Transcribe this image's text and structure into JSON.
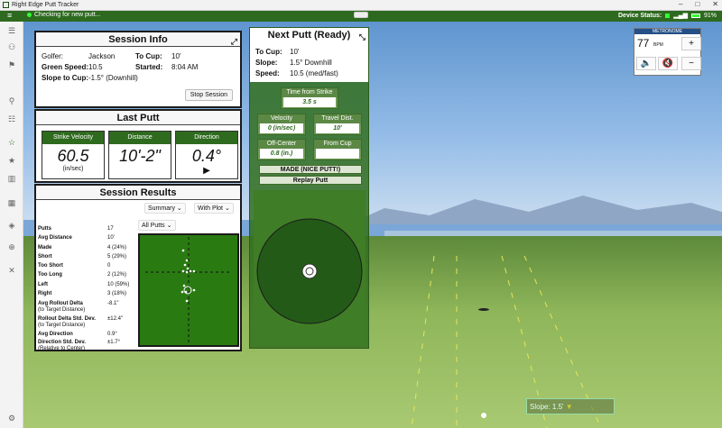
{
  "window": {
    "title": "Right Edge Putt Tracker",
    "minimize": "–",
    "maximize": "□",
    "close": "✕"
  },
  "toolbar": {
    "status_text": "Checking for new putt...",
    "device_status_label": "Device Status:",
    "battery": "91%"
  },
  "sidebar": {
    "items": [
      "menu",
      "people",
      "golf-flag",
      "person-add",
      "list",
      "star-outline",
      "star-fill",
      "building",
      "chart",
      "layers",
      "globe",
      "close",
      "gear"
    ]
  },
  "session_info": {
    "title": "Session Info",
    "golfer_label": "Golfer:",
    "golfer": "Jackson",
    "to_cup_label": "To Cup:",
    "to_cup": "10'",
    "green_speed_label": "Green Speed:",
    "green_speed": "10.5",
    "started_label": "Started:",
    "started": "8:04 AM",
    "slope_label": "Slope to Cup:",
    "slope": "-1.5° (Downhill)",
    "stop_button": "Stop Session"
  },
  "last_putt": {
    "title": "Last Putt",
    "boxes": [
      {
        "label": "Strike Velocity",
        "value": "60.5",
        "unit": "(in/sec)"
      },
      {
        "label": "Distance",
        "value": "10'-2\"",
        "unit": ""
      },
      {
        "label": "Direction",
        "value": "0.4°",
        "unit": ""
      }
    ],
    "direction_arrow": "▶"
  },
  "session_results": {
    "title": "Session Results",
    "view_select": "Summary",
    "plot_select": "With Plot",
    "putt_filter": "All Putts",
    "rows": [
      {
        "k": "Putts",
        "v": "17"
      },
      {
        "k": "Avg Distance",
        "v": "10'"
      },
      {
        "k": "Made",
        "v": "4 (24%)"
      },
      {
        "k": "Short",
        "v": "5 (29%)"
      },
      {
        "k": "Too Short",
        "v": "0"
      },
      {
        "k": "Too Long",
        "v": "2 (12%)"
      },
      {
        "k": "Left",
        "v": "10 (59%)"
      },
      {
        "k": "Right",
        "v": "3 (18%)"
      },
      {
        "k": "Avg Rollout Delta",
        "sub": "(to Target Distance)",
        "v": "-8.1\""
      },
      {
        "k": "Rollout Delta Std. Dev.",
        "sub": "(to Target Distance)",
        "v": "±12.4\""
      },
      {
        "k": "Avg Direction",
        "v": "0.9°"
      },
      {
        "k": "Direction Std. Dev.",
        "sub": "(Relative to Center)",
        "v": "±1.7°"
      }
    ],
    "dropdown_arrow": "⌄"
  },
  "next_putt": {
    "title": "Next Putt (Ready)",
    "to_cup_label": "To Cup:",
    "to_cup": "10'",
    "slope_label": "Slope:",
    "slope": "1.5° Downhill",
    "speed_label": "Speed:",
    "speed": "10.5 (med/fast)",
    "time_label": "Time from Strike",
    "time_value": "3.5 s",
    "velocity_label": "Velocity",
    "velocity_value": "0 (in/sec)",
    "travel_label": "Travel Dist.",
    "travel_value": "10'",
    "offcenter_label": "Off-Center",
    "offcenter_value": "0.8 (in.)",
    "fromcup_label": "From Cup",
    "fromcup_value": "",
    "made_text": "MADE (NICE PUTT!)",
    "replay_label": "Replay Putt"
  },
  "metronome": {
    "title": "METRONOME",
    "bpm": "77",
    "bpm_unit": "BPM",
    "plus": "+",
    "minus": "−"
  },
  "overlay": {
    "slope_text": "Slope: 1.5'"
  },
  "colors": {
    "accent_green": "#2d6a1f",
    "toolbar_green": "#2d6a1f",
    "metronome_blue": "#244f87"
  }
}
